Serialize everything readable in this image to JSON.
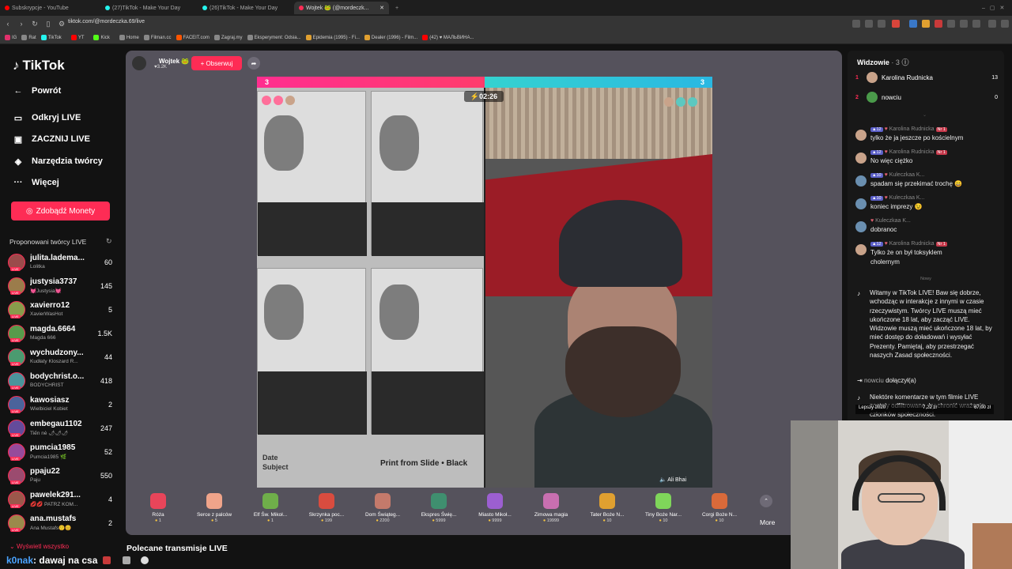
{
  "browser": {
    "tabs": [
      {
        "label": "Subskrypcje - YouTube",
        "icon_color": "#ff0000"
      },
      {
        "label": "(27)TikTok - Make Your Day",
        "icon_color": "#25f4ee"
      },
      {
        "label": "(26)TikTok - Make Your Day",
        "icon_color": "#25f4ee"
      },
      {
        "label": "Wojtek 🐸 (@mordeczk...",
        "icon_color": "#fe2c55"
      }
    ],
    "url": "tiktok.com/@mordeczka.69/live",
    "bookmarks": [
      "IG",
      "Rat",
      "TikTok",
      "YT",
      "Kick",
      "Home",
      "Filman.cc",
      "FACEIT.com",
      "Zagraj.my",
      "Eksperyment: Odsia...",
      "Epidemia (1995) - Fi...",
      "Dealer (1996) - Film...",
      "(42) ♥ МАЛЬВИНА..."
    ]
  },
  "sidebar": {
    "logo": "TikTok",
    "nav": [
      {
        "label": "Powrót",
        "icon": "arrow-left-icon",
        "glyph": "←"
      },
      {
        "label": "Odkryj LIVE",
        "icon": "compass-icon",
        "glyph": "▭"
      },
      {
        "label": "ZACZNIJ LIVE",
        "icon": "camera-icon",
        "glyph": "▣"
      },
      {
        "label": "Narzędzia twórcy",
        "icon": "lightbulb-icon",
        "glyph": "◈"
      },
      {
        "label": "Więcej",
        "icon": "more-icon",
        "glyph": "···"
      }
    ],
    "coins_button": "Zdobądź Monety",
    "suggested_title": "Proponowani twórcy LIVE",
    "creators": [
      {
        "name": "julita.ladema...",
        "sub": "Lolitka",
        "count": "60"
      },
      {
        "name": "justysia3737",
        "sub": "💓Justysia💓",
        "count": "145"
      },
      {
        "name": "xavierro12",
        "sub": "XavierWasHot",
        "count": "5"
      },
      {
        "name": "magda.6664",
        "sub": "Magda 666",
        "count": "1.5K"
      },
      {
        "name": "wychudzony...",
        "sub": "Kudłaty Kloszard R...",
        "count": "44"
      },
      {
        "name": "bodychrist.o...",
        "sub": "BODYCHRIST",
        "count": "418"
      },
      {
        "name": "kawosiasz",
        "sub": "Wielbiciel Kobiet",
        "count": "2"
      },
      {
        "name": "embegau1102",
        "sub": "Tiến nè 🌶🌶🌶",
        "count": "247"
      },
      {
        "name": "pumcia1985",
        "sub": "Pumcia1985 🌿",
        "count": "52"
      },
      {
        "name": "ppaju22",
        "sub": "Paju",
        "count": "550"
      },
      {
        "name": "pawelek291...",
        "sub": "💋💋 PATRZ KOM...",
        "count": "4"
      },
      {
        "name": "ana.mustafs",
        "sub": "Ana Mustafs🙂😊",
        "count": "2"
      }
    ],
    "live_badge": "LIVE",
    "show_all": "Wyświetl wszystko"
  },
  "stage": {
    "host_name": "Wojtek 🐸",
    "host_fans": "3.2K",
    "follow_label": "+ Obserwuj",
    "score_left": "3",
    "score_right": "3",
    "timer": "02:26",
    "left_caption_1": "Date",
    "left_caption_2": "Subject",
    "left_caption_3": "Print from Slide • Black",
    "opponent_name": "Ali Bhai",
    "gifts": [
      {
        "name": "Róża",
        "price": "1",
        "color": "#e8455a"
      },
      {
        "name": "Serce z palców",
        "price": "5",
        "color": "#f0a48a"
      },
      {
        "name": "Elf Św. Mikoł...",
        "price": "1",
        "color": "#6fae4a"
      },
      {
        "name": "Skrzynka poc...",
        "price": "199",
        "color": "#d94c3f"
      },
      {
        "name": "Dom Świąteg...",
        "price": "2200",
        "color": "#c47a6b"
      },
      {
        "name": "Ekspres Świę...",
        "price": "5999",
        "color": "#3f8f6f"
      },
      {
        "name": "Miasto Mikoł...",
        "price": "9999",
        "color": "#9c5fd1"
      },
      {
        "name": "Zimowa magia",
        "price": "19999",
        "color": "#c86fb0"
      },
      {
        "name": "Tater Boże N...",
        "price": "10",
        "color": "#e0a030"
      },
      {
        "name": "Tiny Boże Nar...",
        "price": "10",
        "color": "#7fd65a"
      },
      {
        "name": "Corgi Boże N...",
        "price": "10",
        "color": "#d96a3a"
      }
    ],
    "more_label": "More",
    "below_title": "Polecane transmisje LIVE"
  },
  "chat": {
    "viewers_title": "Widzowie",
    "viewers_count": "3",
    "viewers": [
      {
        "rank": "1",
        "name": "Karolina Rudnicka",
        "count": "13",
        "color": "#c9a38a"
      },
      {
        "rank": "2",
        "name": "nowciu",
        "count": "0",
        "color": "#4a9a4a"
      }
    ],
    "messages": [
      {
        "lvl": "12",
        "name": "Karolina Rudnicka",
        "badge": "Nr 1",
        "text": "tylko że ja jeszcze po kościelnym"
      },
      {
        "lvl": "12",
        "name": "Karolina Rudnicka",
        "badge": "Nr 1",
        "text": "No więc ciężko"
      },
      {
        "lvl": "10",
        "name": "Kuleczkaa K...",
        "badge": "",
        "text": "spadam się przekimać trochę 😄"
      },
      {
        "lvl": "10",
        "name": "Kuleczkaa K...",
        "badge": "",
        "text": "koniec imprezy 😉"
      },
      {
        "lvl": "",
        "name": "Kuleczkaa K...",
        "badge": "",
        "text": "dobranoc"
      },
      {
        "lvl": "12",
        "name": "Karolina Rudnicka",
        "badge": "Nr 1",
        "text": "Tylko że on był toksyklem"
      }
    ],
    "last_line": "cholernym",
    "new_divider": "Nowy",
    "system_message": "Witamy w TikTok LIVE! Baw się dobrze, wchodząc w interakcje z innymi w czasie rzeczywistym. Twórcy LIVE muszą mieć ukończone 18 lat, aby zacząć LIVE. Widzowie muszą mieć ukończone 18 lat, by mieć dostęp do doładowań i wysyłać Prezenty. Pamiętaj, aby przestrzegać naszych Zasad społeczności.",
    "join_user": "nowciu",
    "join_text": "dołączył(a)",
    "filter_message": "Niektóre komentarze w tym filmie LIVE zostały odfiltrowane, by chronić wrażenia członków społeczności."
  },
  "overlay": {
    "tag_left": "Lepszy 2020",
    "tag_mid": "7,22 zł",
    "tag_right": "67,00 zł",
    "chat_user": "k0nak",
    "chat_text": ": dawaj na csa"
  }
}
